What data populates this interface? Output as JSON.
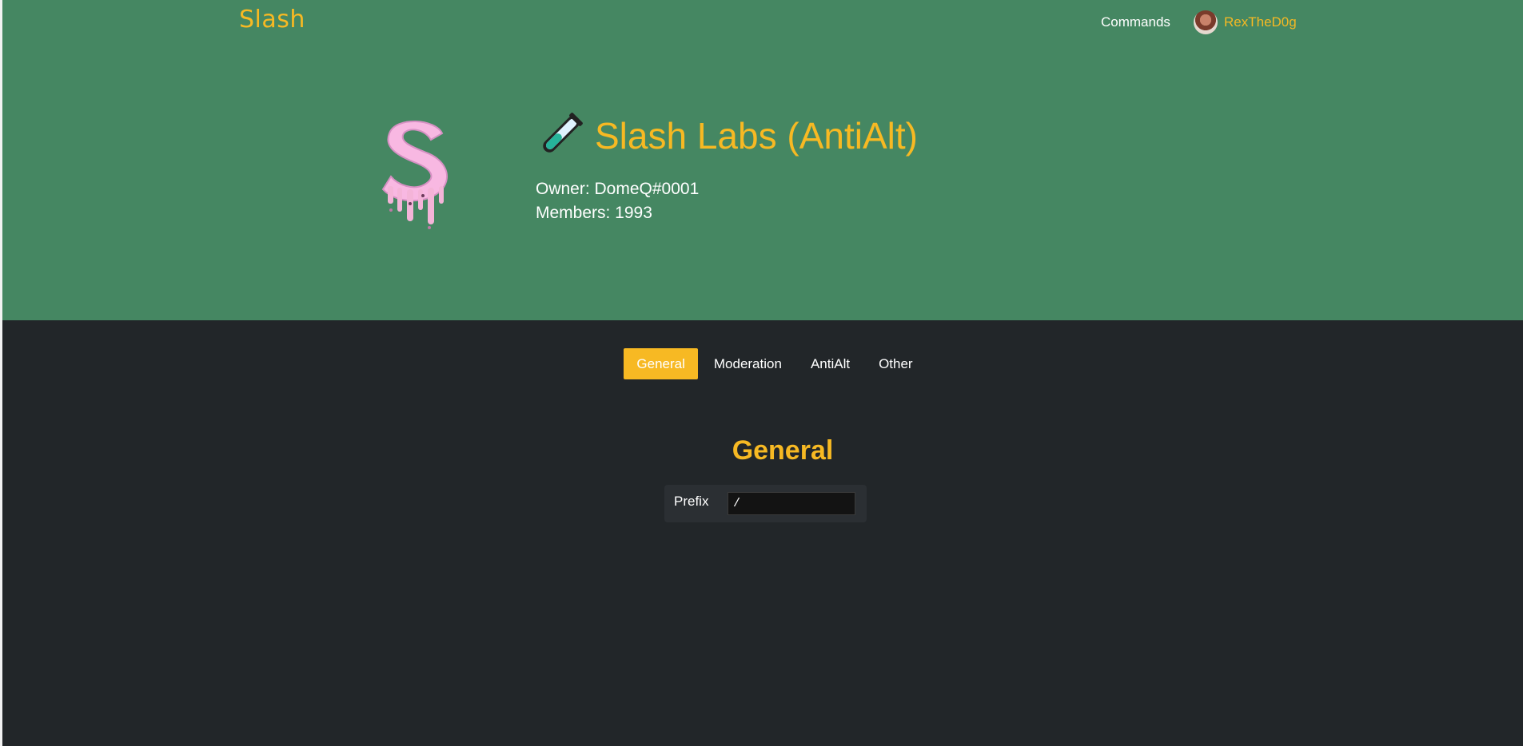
{
  "nav": {
    "brand": "Slash",
    "commands_label": "Commands",
    "user_name": "RexTheD0g"
  },
  "server": {
    "name": "Slash Labs (AntiAlt)",
    "owner_line": "Owner: DomeQ#0001",
    "members_line": "Members: 1993"
  },
  "tabs": [
    {
      "label": "General",
      "active": true
    },
    {
      "label": "Moderation",
      "active": false
    },
    {
      "label": "AntiAlt",
      "active": false
    },
    {
      "label": "Other",
      "active": false
    }
  ],
  "section": {
    "title": "General",
    "settings": [
      {
        "label": "Prefix",
        "value": "/"
      }
    ]
  },
  "colors": {
    "hero_bg": "#458762",
    "page_bg": "#222629",
    "accent": "#f7b923"
  }
}
